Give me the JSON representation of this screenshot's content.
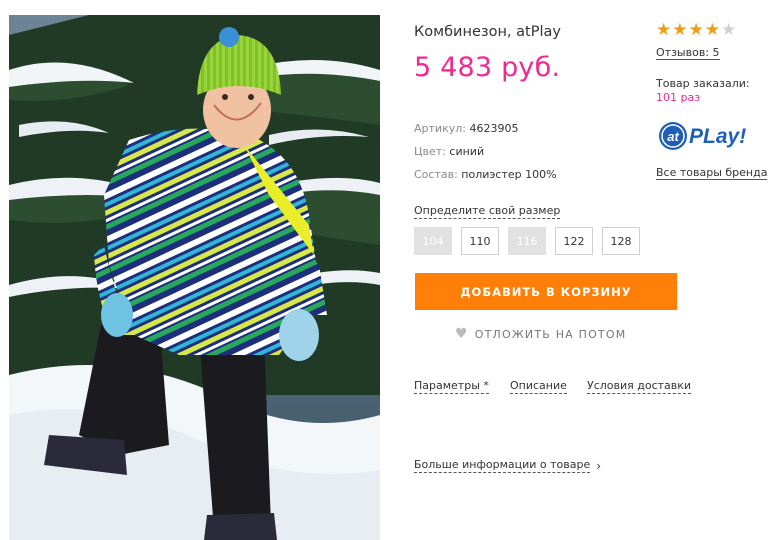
{
  "product": {
    "image_alt": "Child in winter overall in the snow",
    "title": "Комбинезон, atPlay",
    "price": "5 483 руб.",
    "attributes": [
      {
        "key": "Артикул:",
        "value": "4623905"
      },
      {
        "key": "Цвет:",
        "value": "синий"
      },
      {
        "key": "Состав:",
        "value": "полиэстер 100%"
      }
    ]
  },
  "sizes": {
    "link_label": "Определите свой размер",
    "options": [
      {
        "label": "104",
        "available": false
      },
      {
        "label": "110",
        "available": true
      },
      {
        "label": "116",
        "available": false
      },
      {
        "label": "122",
        "available": true
      },
      {
        "label": "128",
        "available": true
      }
    ]
  },
  "actions": {
    "add_to_cart": "ДОБАВИТЬ В КОРЗИНУ",
    "save_for_later": "ОТЛОЖИТЬ НА ПОТОМ"
  },
  "tabs": [
    "Параметры *",
    "Описание",
    "Условия доставки"
  ],
  "more_info": "Больше информации о товаре",
  "rating": {
    "value": 4,
    "max": 5,
    "reviews_label": "Отзывов: 5"
  },
  "orders": {
    "label": "Товар заказали:",
    "count": "101 раз"
  },
  "brand": {
    "logo_badge": "at",
    "logo_text": "PLay!",
    "all_products_link": "Все товары бренда"
  },
  "colors": {
    "price": "#f0288f",
    "cart_button": "#ff7f08",
    "star_active": "#f39c12",
    "logo_blue": "#1f5fb8"
  }
}
